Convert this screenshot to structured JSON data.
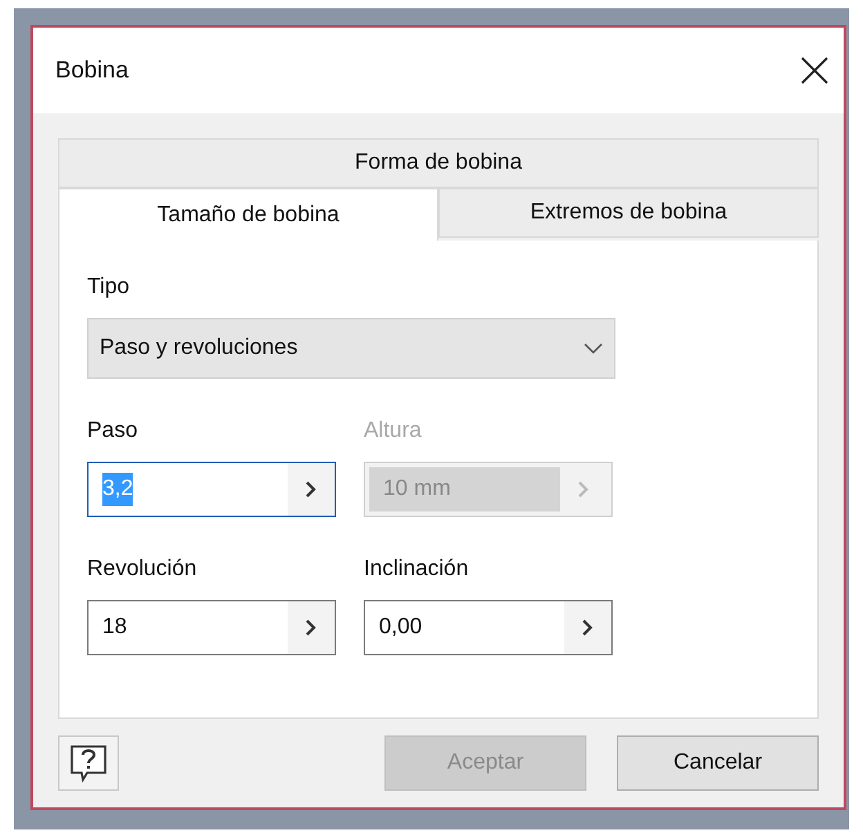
{
  "window": {
    "title": "Bobina"
  },
  "tab_rows": [
    [
      {
        "label": "Forma de bobina",
        "selected": false
      }
    ],
    [
      {
        "label": "Tamaño de bobina",
        "selected": true
      },
      {
        "label": "Extremos de bobina",
        "selected": false
      }
    ]
  ],
  "tipo": {
    "label": "Tipo",
    "value": "Paso y revoluciones"
  },
  "fields": [
    {
      "label": "Paso",
      "value": "3,2",
      "focused": true,
      "text_selected": true,
      "disabled": false
    },
    {
      "label": "Altura",
      "value": "10 mm",
      "focused": false,
      "text_selected": false,
      "disabled": true
    },
    {
      "label": "Revolución",
      "value": "18",
      "focused": false,
      "text_selected": false,
      "disabled": false
    },
    {
      "label": "Inclinación",
      "value": "0,00",
      "focused": false,
      "text_selected": false,
      "disabled": false
    }
  ],
  "buttons": [
    {
      "label": "Aceptar",
      "disabled": true
    },
    {
      "label": "Cancelar",
      "disabled": false
    }
  ]
}
